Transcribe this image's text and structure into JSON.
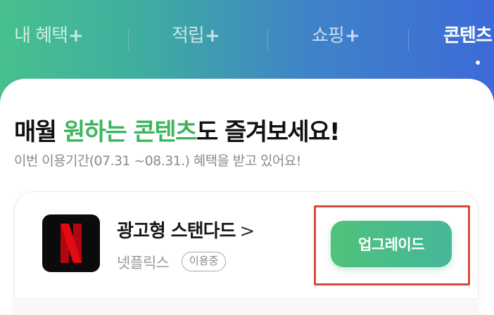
{
  "tabs": [
    {
      "label": "내 혜택",
      "plus": "+"
    },
    {
      "label": "적립",
      "plus": "+"
    },
    {
      "label": "쇼핑",
      "plus": "+"
    },
    {
      "label": "콘텐츠",
      "plus": "+"
    }
  ],
  "active_tab_index": 3,
  "headline": {
    "part1": "매월 ",
    "highlight": "원하는 콘텐츠",
    "part2": "도 즐겨보세요!"
  },
  "subtext": "이번 이용기간(07.31 ~08.31.) 혜택을 받고 있어요!",
  "card": {
    "product_name": "광고형 스탠다드",
    "chevron": ">",
    "provider": "넷플릭스",
    "status_badge": "이용중",
    "upgrade_button": "업그레이드",
    "app_icon": "netflix-logo-icon"
  },
  "colors": {
    "accent_green": "#3cb55b",
    "button_green": "#4fc27a",
    "highlight_red": "#d64a3b",
    "netflix_red": "#e50914"
  }
}
